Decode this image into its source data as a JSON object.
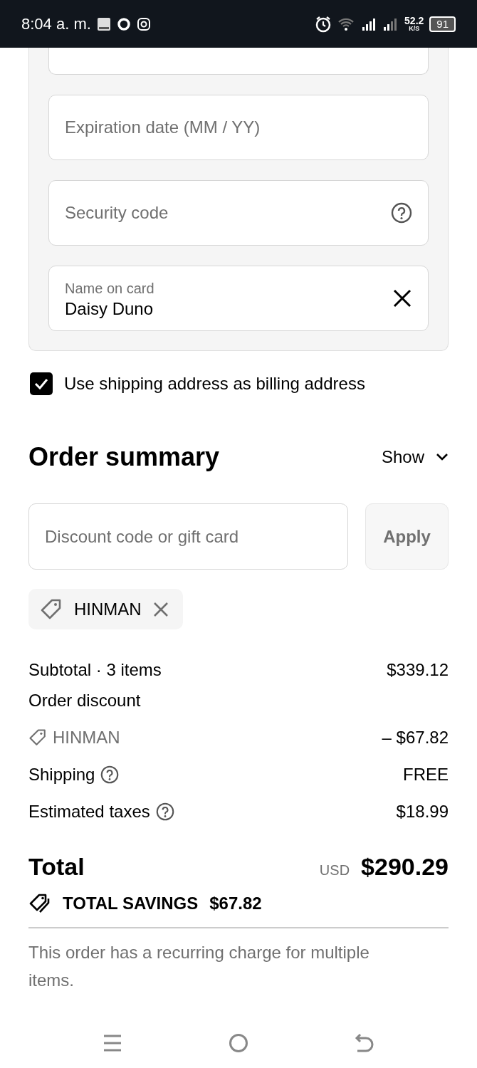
{
  "status_bar": {
    "time": "8:04 a. m.",
    "speed": "52.2",
    "speed_unit": "K/S",
    "battery": "91"
  },
  "card_fields": [
    {
      "kind": "cut"
    },
    {
      "kind": "text",
      "placeholder": "Expiration date (MM / YY)"
    },
    {
      "kind": "help",
      "placeholder": "Security code"
    },
    {
      "kind": "clear",
      "label": "Name on card",
      "value": "Daisy Duno"
    }
  ],
  "billing_checkbox": {
    "label": "Use shipping address as billing address",
    "checked": true
  },
  "order_summary": {
    "title": "Order summary",
    "toggle": "Show",
    "expanded": false
  },
  "discount": {
    "placeholder": "Discount code or gift card",
    "button": "Apply",
    "disabled": true
  },
  "applied_codes": [
    {
      "code": "HINMAN"
    }
  ],
  "lines": [
    {
      "kind": "plain",
      "label": "Subtotal · 3 items",
      "value": "$339.12"
    },
    {
      "kind": "heading",
      "label": "Order discount"
    },
    {
      "kind": "code",
      "label": "HINMAN",
      "value": "– $67.82"
    },
    {
      "kind": "help",
      "label": "Shipping",
      "value": "FREE"
    },
    {
      "kind": "help",
      "label": "Estimated taxes",
      "value": "$18.99"
    }
  ],
  "total": {
    "label": "Total",
    "currency": "USD",
    "value": "$290.29"
  },
  "savings": {
    "label": "TOTAL SAVINGS",
    "value": "$67.82"
  },
  "note": "This order has a recurring charge for multiple items."
}
